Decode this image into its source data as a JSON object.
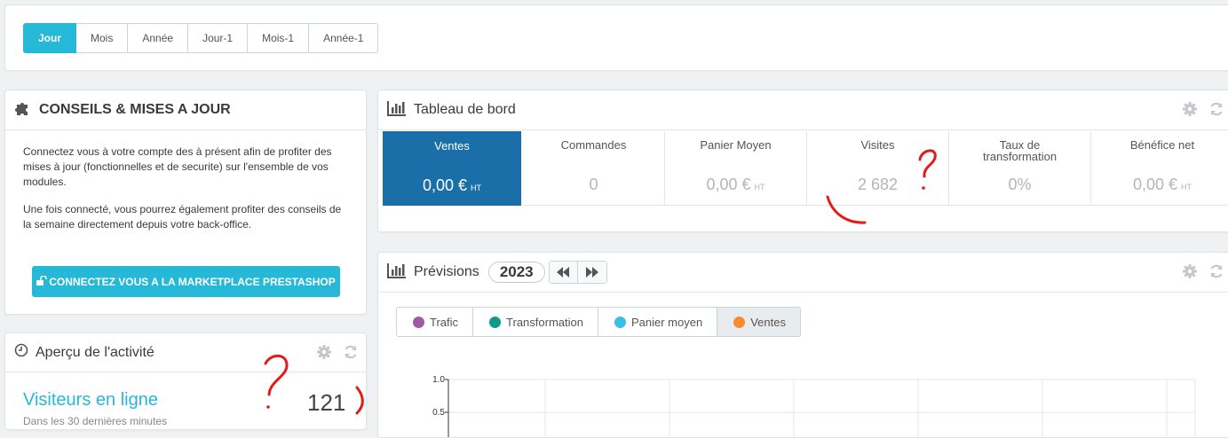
{
  "period_bar": {
    "buttons": [
      "Jour",
      "Mois",
      "Année",
      "Jour-1",
      "Mois-1",
      "Année-1"
    ],
    "active": "Jour"
  },
  "conseils": {
    "title": "CONSEILS & MISES A JOUR",
    "paragraph1": "Connectez vous à votre compte des à présent afin de profiter des mises à jour (fonctionnelles et de securite) sur l'ensemble de vos modules.",
    "paragraph2": "Une fois connecté, vous pourrez également profiter des conseils de la semaine directement depuis votre back-office.",
    "button_label": "CONNECTEZ VOUS A LA MARKETPLACE PRESTASHOP"
  },
  "activity": {
    "title": "Aperçu de l'activité",
    "visitors_label": "Visiteurs en ligne",
    "visitors_sub": "Dans les 30 dernières minutes",
    "visitors_count": "121"
  },
  "dashboard": {
    "title": "Tableau de bord",
    "kpis": [
      {
        "label": "Ventes",
        "value": "0,00 €",
        "suffix": "HT"
      },
      {
        "label": "Commandes",
        "value": "0",
        "suffix": ""
      },
      {
        "label": "Panier Moyen",
        "value": "0,00 €",
        "suffix": "HT"
      },
      {
        "label": "Visites",
        "value": "2 682",
        "suffix": ""
      },
      {
        "label": "Taux de transformation",
        "value": "0%",
        "suffix": ""
      },
      {
        "label": "Bénéfice net",
        "value": "0,00 €",
        "suffix": "HT"
      }
    ]
  },
  "previsions": {
    "title": "Prévisions",
    "year": "2023",
    "tabs": [
      {
        "label": "Trafic",
        "color": "#9e5ba1"
      },
      {
        "label": "Transformation",
        "color": "#0f9a8a"
      },
      {
        "label": "Panier moyen",
        "color": "#3bbde8"
      },
      {
        "label": "Ventes",
        "color": "#f78d2e"
      }
    ],
    "y_ticks": [
      "1.0",
      "0.5"
    ]
  },
  "icons": {
    "puzzle": "puzzle-icon",
    "bar_chart": "bar-chart-icon",
    "clock": "clock-icon",
    "gear": "gear-icon",
    "refresh": "refresh-icon",
    "lock": "unlock-icon",
    "prev": "backward-icon",
    "next": "forward-icon"
  },
  "colors": {
    "accent": "#25b9d7",
    "kpi_active": "#1a6fa8",
    "annotation": "#e31b1b"
  }
}
